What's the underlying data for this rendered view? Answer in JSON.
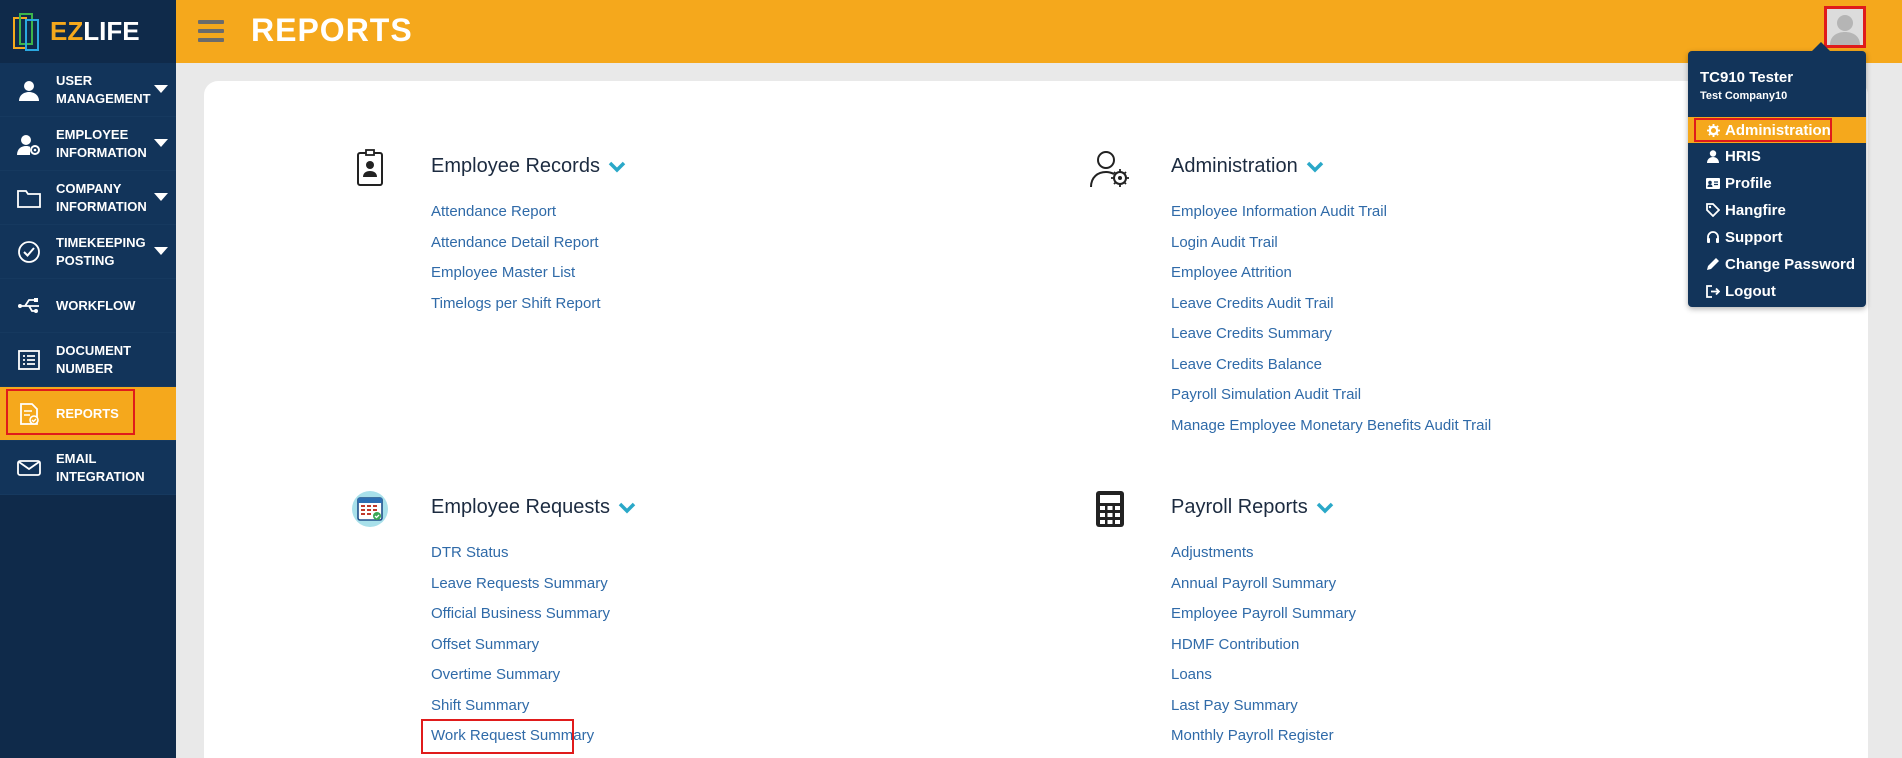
{
  "app": {
    "logo_text_ez": "EZ",
    "logo_text_life": "LIFE"
  },
  "header": {
    "title": "REPORTS"
  },
  "sidebar": {
    "items": [
      {
        "line1": "USER",
        "line2": "MANAGEMENT",
        "icon": "user-icon",
        "caret": true
      },
      {
        "line1": "EMPLOYEE",
        "line2": "INFORMATION",
        "icon": "user-gear-icon",
        "caret": true
      },
      {
        "line1": "COMPANY",
        "line2": "INFORMATION",
        "icon": "folder-icon",
        "caret": true
      },
      {
        "line1": "TIMEKEEPING",
        "line2": "POSTING",
        "icon": "check-circle-icon",
        "caret": true
      },
      {
        "line1": "WORKFLOW",
        "line2": "",
        "icon": "usb-icon",
        "caret": false
      },
      {
        "line1": "DOCUMENT",
        "line2": "NUMBER",
        "icon": "list-icon",
        "caret": false
      },
      {
        "line1": "REPORTS",
        "line2": "",
        "icon": "report-icon",
        "caret": false,
        "active": true
      },
      {
        "line1": "EMAIL",
        "line2": "INTEGRATION",
        "icon": "envelope-icon",
        "caret": false
      }
    ]
  },
  "sections": {
    "employee_records": {
      "title": "Employee Records",
      "links": [
        "Attendance Report",
        "Attendance Detail Report",
        "Employee Master List",
        "Timelogs per Shift Report"
      ]
    },
    "administration": {
      "title": "Administration",
      "links": [
        "Employee Information Audit Trail",
        "Login Audit Trail",
        "Employee Attrition",
        "Leave Credits Audit Trail",
        "Leave Credits Summary",
        "Leave Credits Balance",
        "Payroll Simulation Audit Trail",
        "Manage Employee Monetary Benefits Audit Trail"
      ]
    },
    "employee_requests": {
      "title": "Employee Requests",
      "links": [
        "DTR Status",
        "Leave Requests Summary",
        "Official Business Summary",
        "Offset Summary",
        "Overtime Summary",
        "Shift Summary",
        "Work Request Summary"
      ]
    },
    "payroll_reports": {
      "title": "Payroll Reports",
      "links": [
        "Adjustments",
        "Annual Payroll Summary",
        "Employee Payroll Summary",
        "HDMF Contribution",
        "Loans",
        "Last Pay Summary",
        "Monthly Payroll Register"
      ]
    }
  },
  "user_menu": {
    "user_name": "TC910 Tester",
    "company": "Test Company10",
    "items": [
      {
        "label": "Administration",
        "icon": "gear-icon",
        "active": true
      },
      {
        "label": "HRIS",
        "icon": "user-icon"
      },
      {
        "label": "Profile",
        "icon": "id-card-icon"
      },
      {
        "label": "Hangfire",
        "icon": "tags-icon"
      },
      {
        "label": "Support",
        "icon": "headset-icon"
      },
      {
        "label": "Change Password",
        "icon": "pencil-icon"
      },
      {
        "label": "Logout",
        "icon": "sign-out-icon"
      }
    ]
  },
  "colors": {
    "accent": "#f5a81c",
    "sidebar": "#0f2a4a",
    "link": "#2f6aa8",
    "highlight": "#e01b1b"
  }
}
